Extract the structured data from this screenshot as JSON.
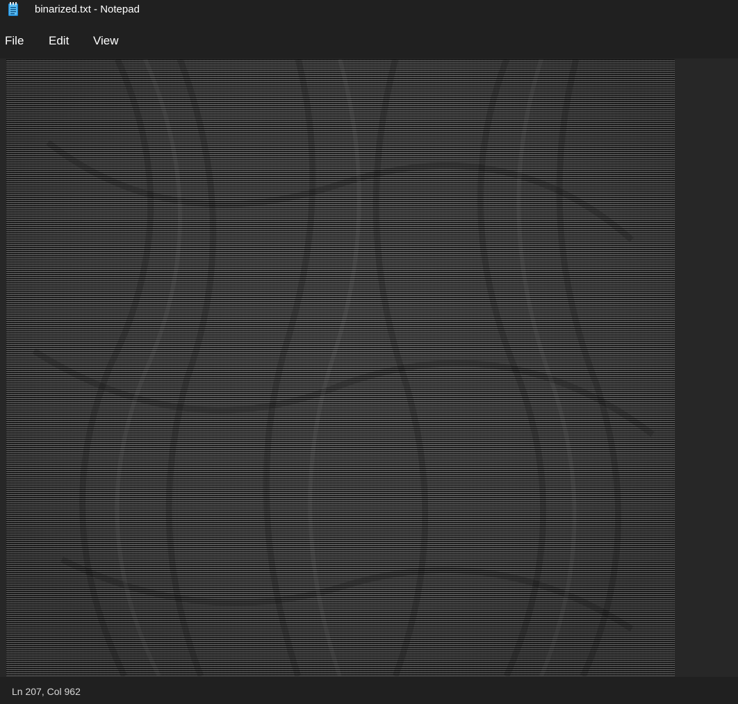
{
  "window": {
    "title": "binarized.txt - Notepad",
    "app_icon": "notepad-icon"
  },
  "menu": {
    "file": "File",
    "edit": "Edit",
    "view": "View"
  },
  "editor": {
    "content_description_icon": "binary-text-field"
  },
  "status": {
    "position": "Ln 207, Col 962"
  },
  "colors": {
    "background": "#202020",
    "editor_background": "#272727",
    "text": "#ffffff",
    "icon_accent": "#3aa0e0"
  }
}
